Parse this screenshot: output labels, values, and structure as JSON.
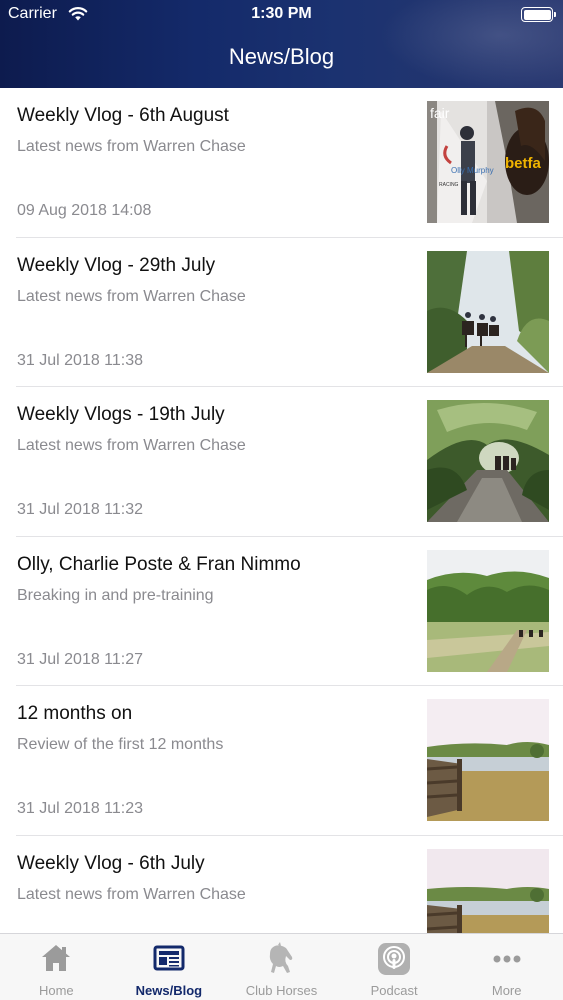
{
  "status_bar": {
    "carrier": "Carrier",
    "time": "1:30 PM"
  },
  "header": {
    "title": "News/Blog"
  },
  "posts": [
    {
      "title": "Weekly Vlog - 6th August",
      "subtitle": "Latest news from Warren Chase",
      "date": "09 Aug 2018 14:08",
      "thumb_text_1": "fair",
      "thumb_text_2": "betfa",
      "thumb_text_3": "Olly Murphy",
      "thumb_text_4": "RACING"
    },
    {
      "title": "Weekly Vlog - 29th July",
      "subtitle": "Latest news from Warren Chase",
      "date": "31 Jul 2018 11:38"
    },
    {
      "title": "Weekly Vlogs - 19th July",
      "subtitle": "Latest news from Warren Chase",
      "date": "31 Jul 2018 11:32"
    },
    {
      "title": "Olly, Charlie Poste & Fran Nimmo",
      "subtitle": "Breaking in and pre-training",
      "date": "31 Jul 2018 11:27"
    },
    {
      "title": "12 months on",
      "subtitle": "Review of the first 12 months",
      "date": "31 Jul 2018 11:23"
    },
    {
      "title": "Weekly Vlog - 6th July",
      "subtitle": "Latest news from Warren Chase",
      "date": ""
    }
  ],
  "tabs": [
    {
      "label": "Home",
      "icon": "home-icon"
    },
    {
      "label": "News/Blog",
      "icon": "newspaper-icon"
    },
    {
      "label": "Club Horses",
      "icon": "horse-icon"
    },
    {
      "label": "Podcast",
      "icon": "podcast-icon"
    },
    {
      "label": "More",
      "icon": "more-icon"
    }
  ],
  "colors": {
    "header": "#13296b",
    "active_tab": "#13296b",
    "inactive_tab": "#9b9b9b",
    "secondary_text": "#8a8a8f"
  }
}
